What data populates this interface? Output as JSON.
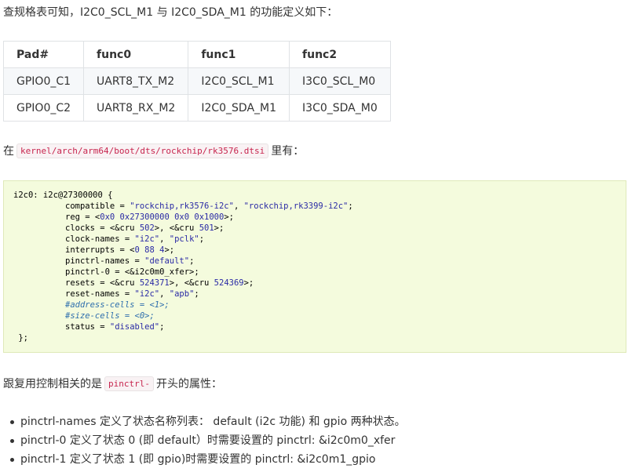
{
  "intro_text": "查规格表可知，I2C0_SCL_M1 与 I2C0_SDA_M1 的功能定义如下：",
  "table": {
    "headers": [
      "Pad#",
      "func0",
      "func1",
      "func2"
    ],
    "rows": [
      [
        "GPIO0_C1",
        "UART8_TX_M2",
        "I2C0_SCL_M1",
        "I3C0_SCL_M0"
      ],
      [
        "GPIO0_C2",
        "UART8_RX_M2",
        "I2C0_SDA_M1",
        "I3C0_SDA_M0"
      ]
    ]
  },
  "path_paragraph": {
    "prefix": "在",
    "code": "kernel/arch/arm64/boot/dts/rockchip/rk3576.dtsi",
    "suffix": "里有："
  },
  "code_block": {
    "line1": "i2c0: i2c@27300000 {",
    "compatible": {
      "key": "compatible = ",
      "str1": "\"rockchip,rk3576-i2c\"",
      "sep": ", ",
      "str2": "\"rockchip,rk3399-i2c\"",
      "end": ";"
    },
    "reg": {
      "key": "reg = <",
      "val": "0x0 0x27300000 0x0 0x1000",
      "end": ">;"
    },
    "clocks": {
      "key": "clocks = <&cru ",
      "v1": "502",
      "mid": ">, <&cru ",
      "v2": "501",
      "end": ">;"
    },
    "clock_names": {
      "key": "clock-names = ",
      "s1": "\"i2c\"",
      "sep": ", ",
      "s2": "\"pclk\"",
      "end": ";"
    },
    "interrupts": {
      "key": "interrupts = <",
      "val": "0 88 4",
      "end": ">;"
    },
    "pinctrl_names": {
      "key": "pinctrl-names = ",
      "s1": "\"default\"",
      "end": ";"
    },
    "pinctrl_0": "pinctrl-0 = <&i2c0m0_xfer>;",
    "resets": {
      "key": "resets = <&cru ",
      "v1": "524371",
      "mid": ">, <&cru ",
      "v2": "524369",
      "end": ">;"
    },
    "reset_names": {
      "key": "reset-names = ",
      "s1": "\"i2c\"",
      "sep": ", ",
      "s2": "\"apb\"",
      "end": ";"
    },
    "address_cells": "#address-cells = <1>;",
    "size_cells": "#size-cells = <0>;",
    "status": {
      "key": "status = ",
      "s1": "\"disabled\"",
      "end": ";"
    },
    "close": " };"
  },
  "pinctrl_paragraph": {
    "prefix": "跟复用控制相关的是",
    "code": "pinctrl-",
    "suffix": "开头的属性："
  },
  "bullets": [
    "pinctrl-names 定义了状态名称列表： default (i2c 功能) 和 gpio 两种状态。",
    "pinctrl-0 定义了状态 0 (即 default）时需要设置的 pinctrl: &i2c0m0_xfer",
    "pinctrl-1 定义了状态 1 (即 gpio)时需要设置的 pinctrl: &i2c0m1_gpio"
  ],
  "colors": {
    "inline_code_text": "#c7254e",
    "code_bg": "#f4fbdd",
    "string": "#2a2aa5",
    "comment": "#2f6fad"
  }
}
